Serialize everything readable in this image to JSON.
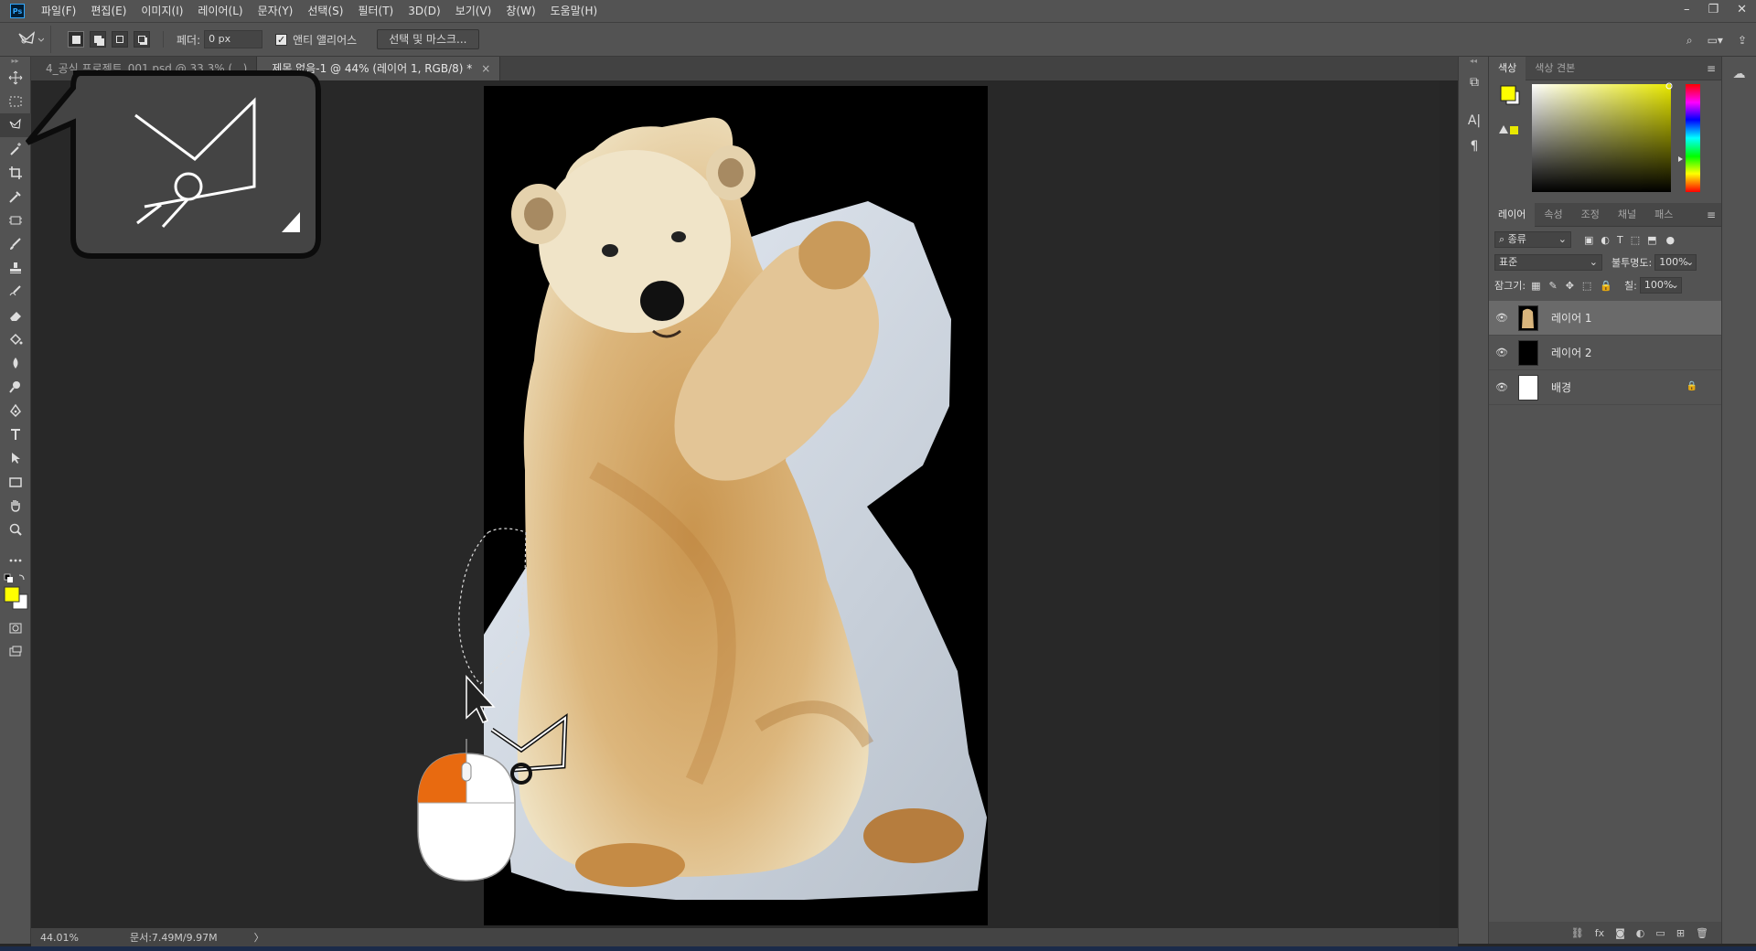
{
  "menu": {
    "items": [
      "파일(F)",
      "편집(E)",
      "이미지(I)",
      "레이어(L)",
      "문자(Y)",
      "선택(S)",
      "필터(T)",
      "3D(D)",
      "보기(V)",
      "창(W)",
      "도움말(H)"
    ],
    "app_icon": "Ps"
  },
  "options": {
    "feather_label": "페더:",
    "feather_value": "0 px",
    "antialias_label": "앤티 앨리어스",
    "antialias_checked": true,
    "select_mask_label": "선택 및 마스크..."
  },
  "tabs": [
    {
      "label": "4_공식 프로젝트_001.psd @ 33.3% (...)",
      "active": false
    },
    {
      "label": "제목 없음-1 @ 44% (레이어 1, RGB/8) *",
      "active": true
    }
  ],
  "status": {
    "zoom": "44.01%",
    "doc": "문서:7.49M/9.97M",
    "arrow": "〉"
  },
  "colors": {
    "foreground": "#ffff00",
    "background": "#ffffff",
    "accent": "#e86a10",
    "picker_hue": "#e8e800"
  },
  "color_panel": {
    "tabs": [
      "색상",
      "색상 견본"
    ]
  },
  "layers_panel": {
    "tabs": [
      "레이어",
      "속성",
      "조정",
      "채널",
      "패스"
    ],
    "filter_label": "종류",
    "blend_mode": "표준",
    "opacity_label": "불투명도:",
    "opacity_value": "100%",
    "lock_label": "잠그기:",
    "fill_label": "칠:",
    "fill_value": "100%",
    "layers": [
      {
        "name": "레이어 1",
        "selected": true,
        "thumb": "bear"
      },
      {
        "name": "레이어 2",
        "selected": false,
        "thumb": "black"
      },
      {
        "name": "배경",
        "selected": false,
        "thumb": "white",
        "locked": true
      }
    ]
  },
  "tools": [
    "move-icon",
    "marquee-icon",
    "polygonal-lasso-icon",
    "magic-wand-icon",
    "crop-icon",
    "eyedropper-icon",
    "frame-icon",
    "brush-icon",
    "stamp-icon",
    "history-brush-icon",
    "eraser-icon",
    "paint-bucket-icon",
    "blur-icon",
    "dodge-icon",
    "pen-icon",
    "type-icon",
    "path-select-icon",
    "rectangle-icon",
    "hand-icon",
    "zoom-icon",
    "more-icon"
  ]
}
